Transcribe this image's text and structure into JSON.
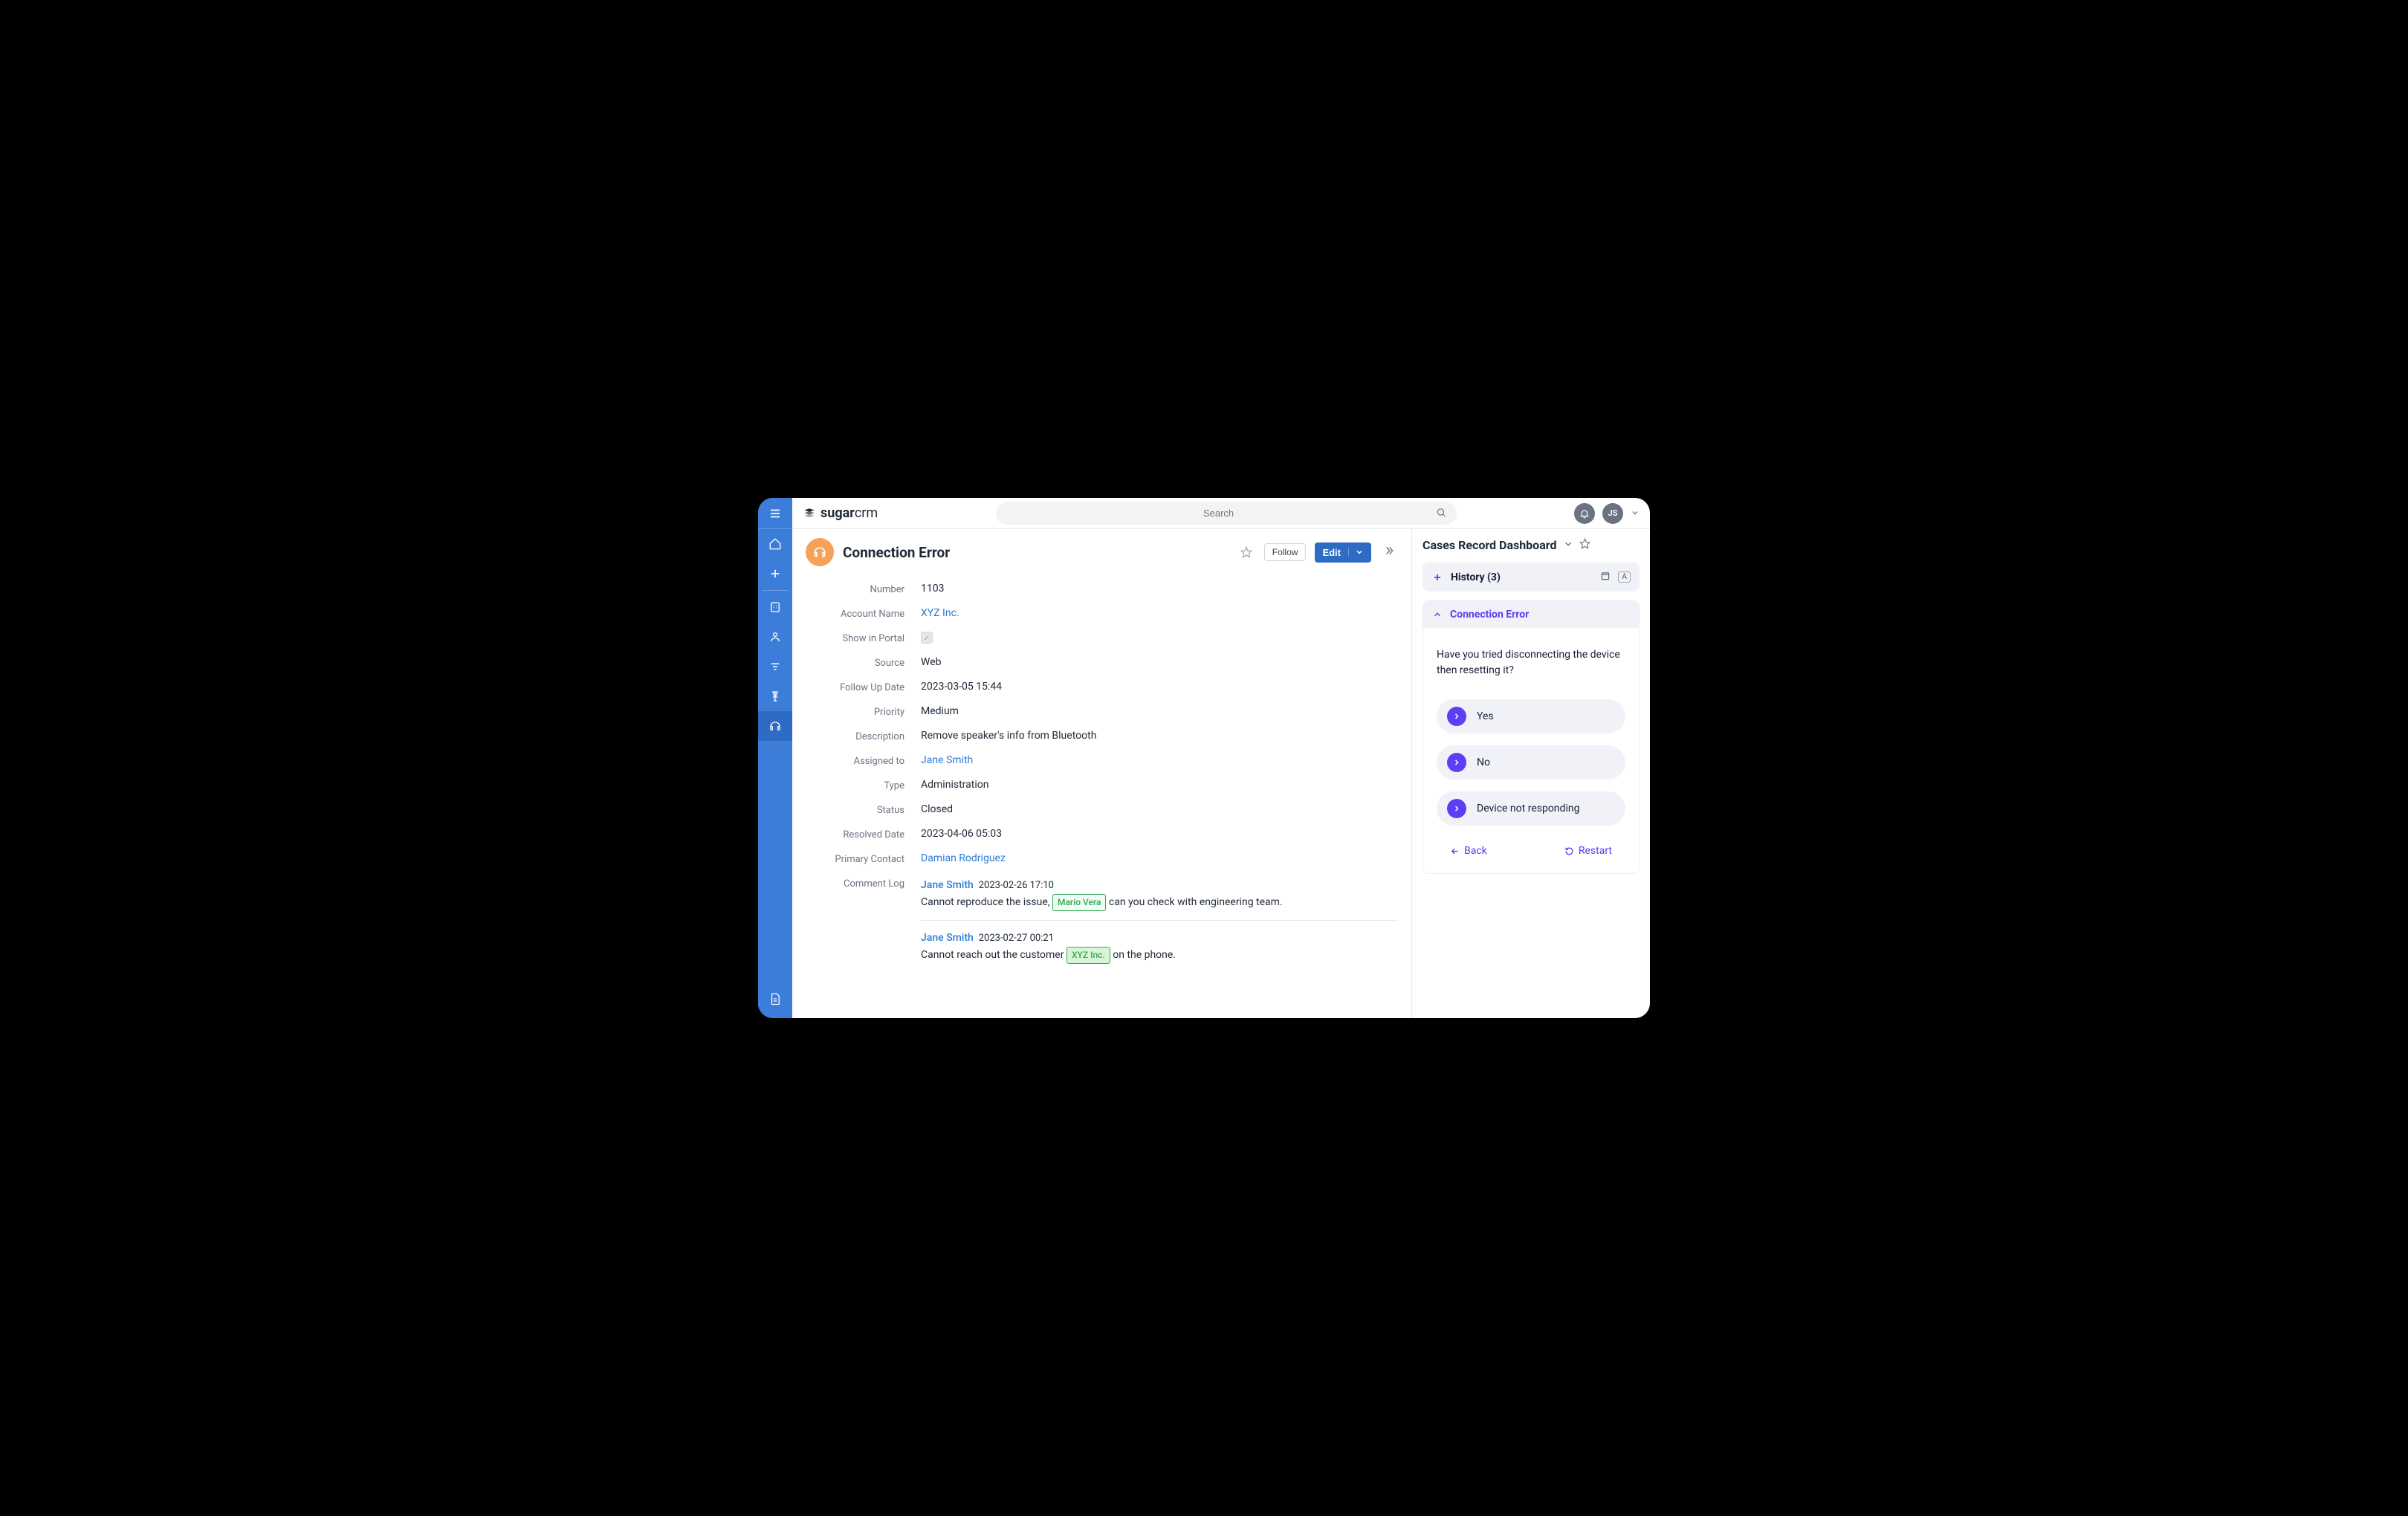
{
  "brand": {
    "name_bold": "sugar",
    "name_light": "crm"
  },
  "search": {
    "placeholder": "Search"
  },
  "user": {
    "initials": "JS"
  },
  "record": {
    "title": "Connection Error",
    "follow_label": "Follow",
    "edit_label": "Edit",
    "fields": {
      "number": {
        "label": "Number",
        "value": "1103"
      },
      "account": {
        "label": "Account Name",
        "value": "XYZ Inc."
      },
      "portal": {
        "label": "Show in Portal"
      },
      "source": {
        "label": "Source",
        "value": "Web"
      },
      "followup": {
        "label": "Follow Up Date",
        "value": "2023-03-05 15:44"
      },
      "priority": {
        "label": "Priority",
        "value": "Medium"
      },
      "description": {
        "label": "Description",
        "value": "Remove speaker's info from Bluetooth"
      },
      "assigned": {
        "label": "Assigned to",
        "value": "Jane Smith"
      },
      "type": {
        "label": "Type",
        "value": "Administration"
      },
      "status": {
        "label": "Status",
        "value": "Closed"
      },
      "resolved": {
        "label": "Resolved Date",
        "value": "2023-04-06 05:03"
      },
      "contact": {
        "label": "Primary Contact",
        "value": "Damian Rodriguez"
      },
      "comments": {
        "label": "Comment Log",
        "items": [
          {
            "author": "Jane Smith",
            "date": "2023-02-26 17:10",
            "text_before": "Cannot reproduce the issue, ",
            "pill": "Mario Vera",
            "text_after": " can you check with engineering team."
          },
          {
            "author": "Jane Smith",
            "date": "2023-02-27 00:21",
            "text_before": "Cannot reach out the customer ",
            "pill": "XYZ Inc.",
            "text_after": " on the phone."
          }
        ]
      }
    }
  },
  "dashboard": {
    "title": "Cases Record Dashboard",
    "history": {
      "label": "History (3)",
      "tag": "A"
    },
    "accordion": {
      "title": "Connection Error",
      "question": "Have you tried disconnecting the device then resetting it?",
      "options": [
        "Yes",
        "No",
        "Device not responding"
      ],
      "back_label": "Back",
      "restart_label": "Restart"
    }
  }
}
